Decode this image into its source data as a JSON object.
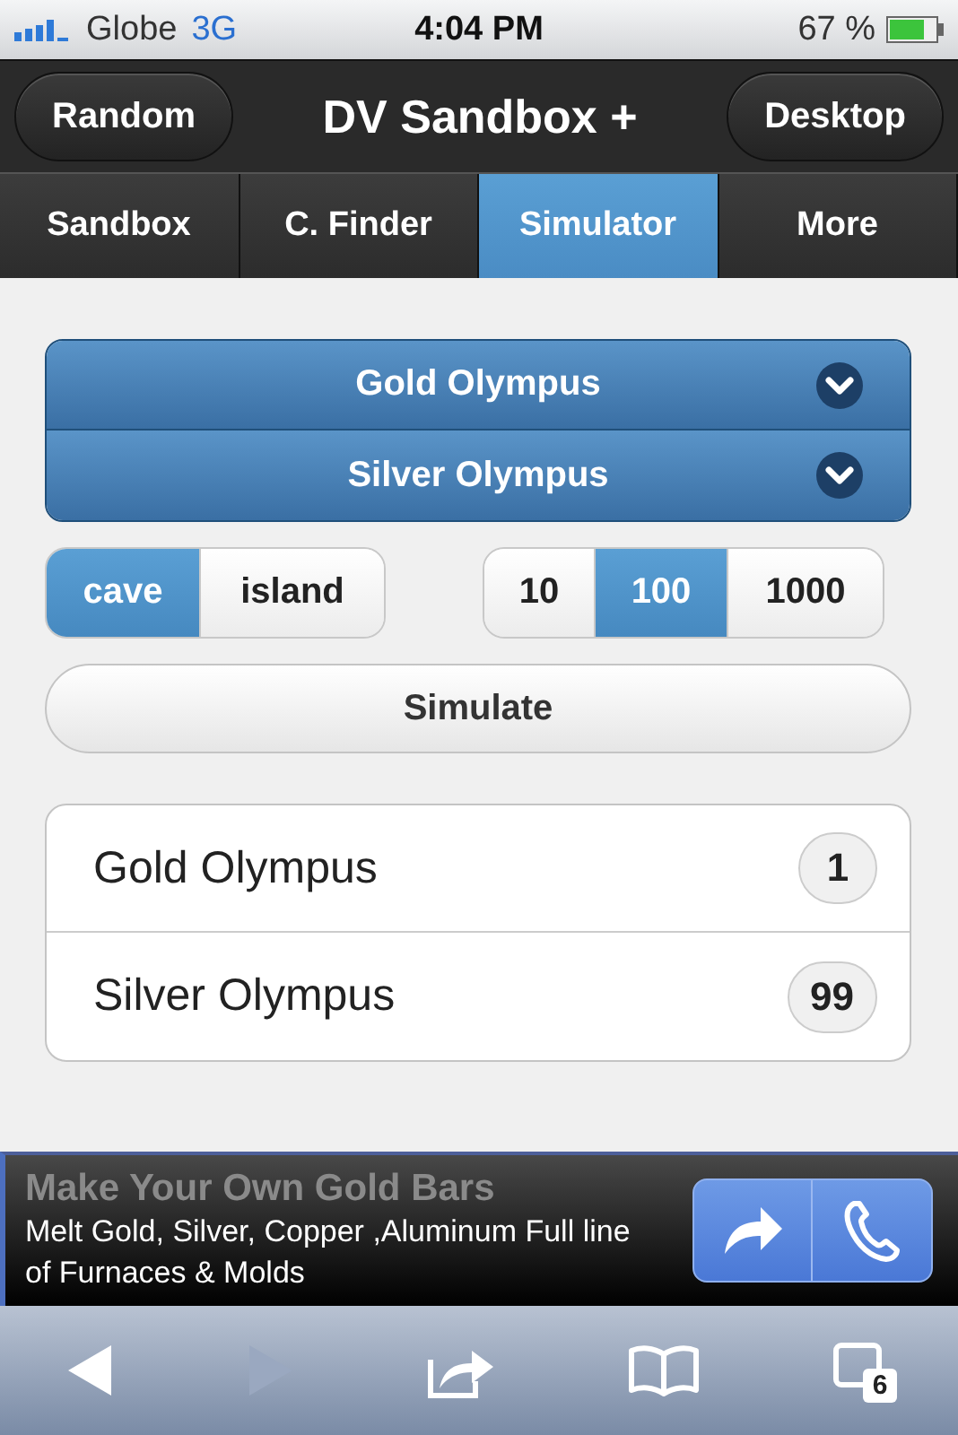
{
  "status_bar": {
    "carrier": "Globe",
    "network": "3G",
    "time": "4:04 PM",
    "battery": "67 %"
  },
  "header": {
    "left_button": "Random",
    "title": "DV Sandbox +",
    "right_button": "Desktop"
  },
  "tabs": [
    {
      "label": "Sandbox",
      "selected": false
    },
    {
      "label": "C. Finder",
      "selected": false
    },
    {
      "label": "Simulator",
      "selected": true
    },
    {
      "label": "More",
      "selected": false
    }
  ],
  "selects": [
    {
      "label": "Gold Olympus"
    },
    {
      "label": "Silver Olympus"
    }
  ],
  "location_options": [
    {
      "label": "cave",
      "selected": true
    },
    {
      "label": "island",
      "selected": false
    }
  ],
  "count_options": [
    {
      "label": "10",
      "selected": false
    },
    {
      "label": "100",
      "selected": true
    },
    {
      "label": "1000",
      "selected": false
    }
  ],
  "simulate_button": "Simulate",
  "results": [
    {
      "name": "Gold Olympus",
      "count": "1"
    },
    {
      "name": "Silver Olympus",
      "count": "99"
    }
  ],
  "ad": {
    "title": "Make Your Own Gold Bars",
    "text": "Melt Gold, Silver, Copper ,Aluminum Full line of Furnaces & Molds"
  },
  "toolbar": {
    "back_disabled": false,
    "forward_disabled": true,
    "tab_count": "6"
  }
}
